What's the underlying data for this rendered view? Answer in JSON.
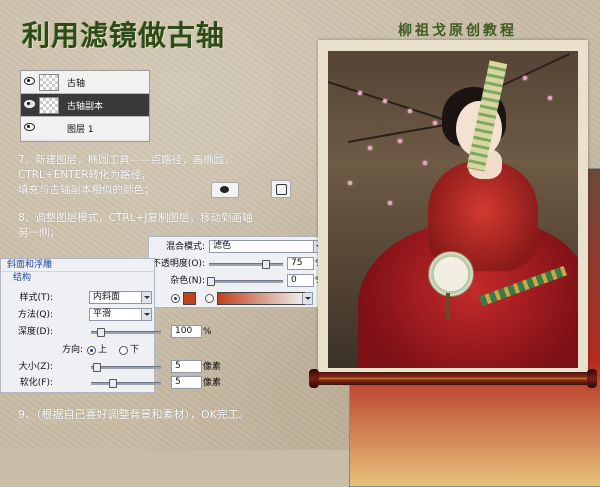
{
  "header": {
    "title": "利用滤镜做古轴",
    "author": "柳祖戈原创教程"
  },
  "layers_panel": {
    "layers": [
      {
        "name": "古轴",
        "selected": false,
        "thumb": "transparent"
      },
      {
        "name": "古轴副本",
        "selected": true,
        "thumb": "transparent"
      },
      {
        "name": "图层 1",
        "selected": false,
        "thumb": "photo"
      }
    ]
  },
  "steps": {
    "step7_line1": "7、新建图层，椭圆工具——点路径，画椭圆，",
    "step7_line2": "CTRL+ENTER转化为路径，",
    "step7_line3": "填充与古轴副本相似的颜色；",
    "step8_line1": "8、调整图层模式，CTRL+J复制图层，移动到画轴",
    "step8_line2": "另一侧；",
    "step9": "9、（根据自己喜好调整背景和素材），OK完工。"
  },
  "tool_icons": {
    "ellipse": "ellipse-tool-icon",
    "path": "path-mode-icon"
  },
  "blend_panel": {
    "mode_label": "混合模式:",
    "mode_value": "滤色",
    "opacity_label": "不透明度(O):",
    "opacity_value": "75",
    "opacity_unit": "%",
    "opacity_fraction": 0.75,
    "noise_label": "杂色(N):",
    "noise_value": "0",
    "noise_unit": "%",
    "swatch_color": "#c2401a"
  },
  "bevel_panel": {
    "section_title": "斜面和浮雕",
    "sub_title": "结构",
    "style_label": "样式(T):",
    "style_value": "内斜面",
    "technique_label": "方法(Q):",
    "technique_value": "平滑",
    "depth_label": "深度(D):",
    "depth_value": "100",
    "depth_unit": "%",
    "direction_label": "方向:",
    "direction_up": "上",
    "direction_down": "下",
    "size_label": "大小(Z):",
    "size_value": "5",
    "size_unit": "像素",
    "soften_label": "软化(F):",
    "soften_value": "5",
    "soften_unit": "像素"
  },
  "colors": {
    "accent_green": "#2e4a18",
    "scroll_red": "#8a2a18"
  }
}
